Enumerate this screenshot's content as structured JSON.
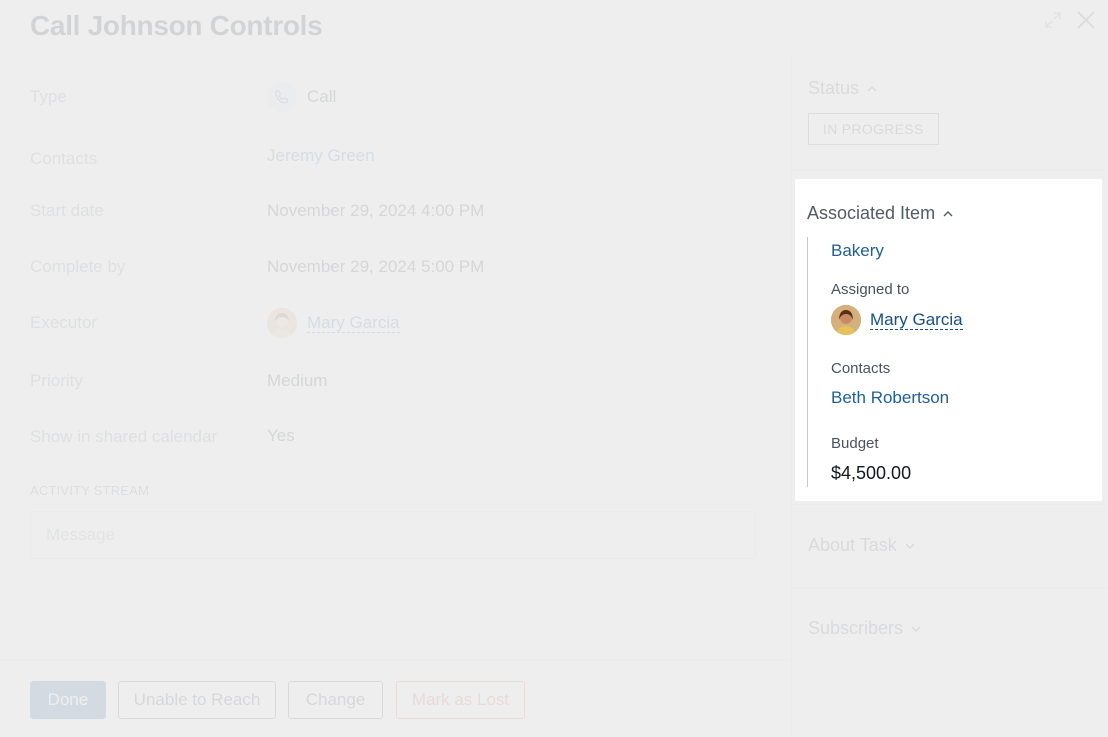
{
  "header": {
    "title": "Call Johnson Controls"
  },
  "details": [
    {
      "label": "Type",
      "value": "Call"
    },
    {
      "label": "Contacts",
      "value": "Jeremy Green"
    },
    {
      "label": "Start date",
      "value": "November 29, 2024 4:00 PM"
    },
    {
      "label": "Complete by",
      "value": "November 29, 2024 5:00 PM"
    },
    {
      "label": "Executor",
      "value": "Mary Garcia"
    },
    {
      "label": "Priority",
      "value": "Medium"
    },
    {
      "label": "Show in shared calendar",
      "value": "Yes"
    }
  ],
  "activity": {
    "label": "ACTIVITY STREAM",
    "placeholder": "Message"
  },
  "footer": {
    "done": "Done",
    "unable": "Unable to Reach",
    "change": "Change",
    "lost": "Mark as Lost"
  },
  "sidebar": {
    "status_title": "Status",
    "status_value": "IN PROGRESS",
    "associated": {
      "title": "Associated Item",
      "item": "Bakery",
      "assigned_label": "Assigned to",
      "assigned_name": "Mary Garcia",
      "contacts_label": "Contacts",
      "contact_name": "Beth Robertson",
      "budget_label": "Budget",
      "budget_value": "$4,500.00"
    },
    "about_title": "About Task",
    "subscribers_title": "Subscribers"
  },
  "colors": {
    "link": "#1f5f99",
    "done_button": "#2f5f9a",
    "lost_button": "#d9534f",
    "overlay": "#ececec"
  },
  "icons": [
    "phone-icon",
    "expand-icon",
    "close-icon",
    "chevron-up-icon",
    "chevron-down-icon"
  ]
}
